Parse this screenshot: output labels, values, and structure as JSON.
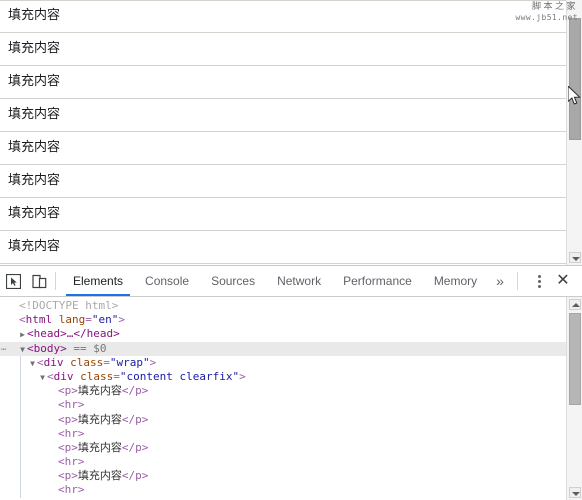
{
  "page": {
    "paragraph_text": "填充内容",
    "rows": [
      {
        "text": "填充内容"
      },
      {
        "text": "填充内容"
      },
      {
        "text": "填充内容"
      },
      {
        "text": "填充内容"
      },
      {
        "text": "填充内容"
      },
      {
        "text": "填充内容"
      },
      {
        "text": "填充内容"
      },
      {
        "text": "填充内容"
      }
    ],
    "watermark": {
      "cn": "脚本之家",
      "en": "www.jb51.net"
    },
    "scrollbar": {
      "down_arrow": "scroll-down-arrow"
    }
  },
  "devtools": {
    "toolbar": {
      "inspect_icon": "inspect-element-icon",
      "device_icon": "device-toolbar-icon",
      "overflow_label": "»",
      "menu_icon": "more-options-icon",
      "close_icon": "close-devtools-icon"
    },
    "tabs": [
      {
        "label": "Elements",
        "active": true
      },
      {
        "label": "Console",
        "active": false
      },
      {
        "label": "Sources",
        "active": false
      },
      {
        "label": "Network",
        "active": false
      },
      {
        "label": "Performance",
        "active": false
      },
      {
        "label": "Memory",
        "active": false
      }
    ],
    "accent_color": "#1a73e8",
    "dom": {
      "doctype": "<!DOCTYPE html>",
      "html_open_lt": "<",
      "html_tag": "html",
      "html_attr_name": "lang",
      "html_attr_eq": "=",
      "html_attr_val": "\"en\"",
      "html_open_gt": ">",
      "head_collapsed": "<head>…</head>",
      "body_tag": "<body>",
      "body_selected_marker": "== $0",
      "wrap_line": "<div class=\"wrap\">",
      "wrap_open_lt": "<",
      "wrap_tag": "div",
      "wrap_attr_name": "class",
      "wrap_attr_val": "\"wrap\"",
      "content_tag": "div",
      "content_attr_name": "class",
      "content_attr_val": "\"content clearfix\"",
      "p_open": "<p>",
      "p_close": "</p>",
      "p_text": "填充内容",
      "hr_line": "<hr>",
      "gt": ">"
    }
  }
}
